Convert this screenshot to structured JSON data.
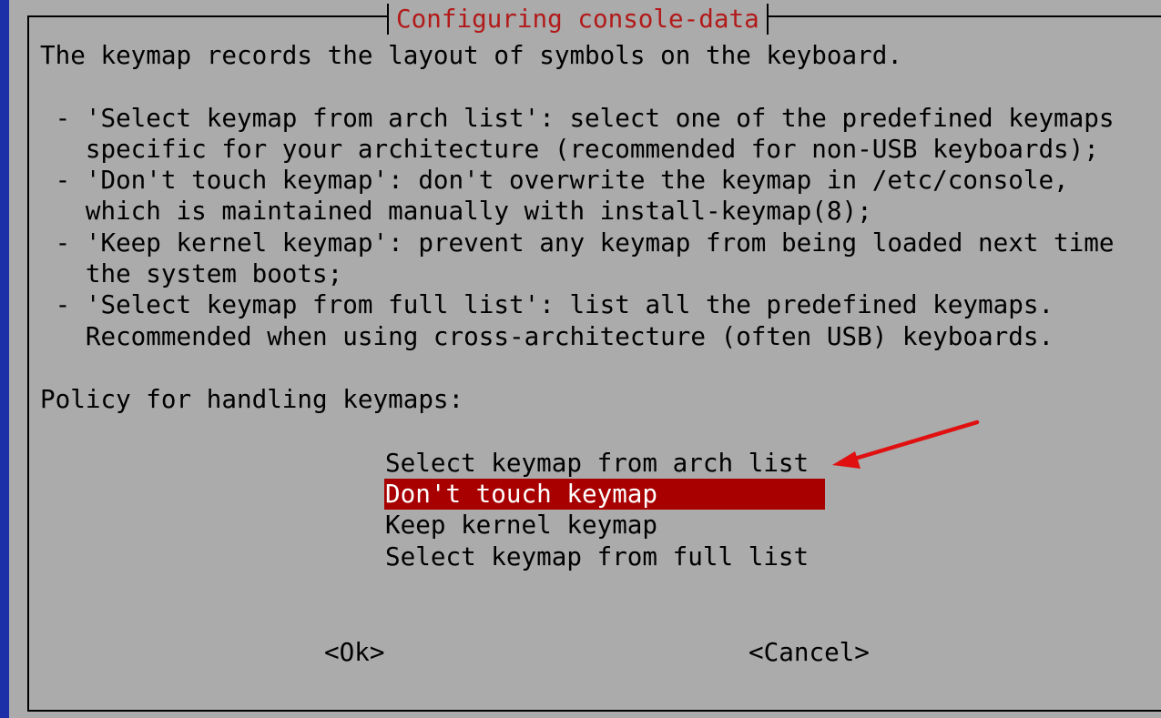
{
  "dialog": {
    "title": "Configuring console-data",
    "description": [
      "The keymap records the layout of symbols on the keyboard.",
      "",
      " - 'Select keymap from arch list': select one of the predefined keymaps",
      "   specific for your architecture (recommended for non-USB keyboards);",
      " - 'Don't touch keymap': don't overwrite the keymap in /etc/console,",
      "   which is maintained manually with install-keymap(8);",
      " - 'Keep kernel keymap': prevent any keymap from being loaded next time",
      "   the system boots;",
      " - 'Select keymap from full list': list all the predefined keymaps.",
      "   Recommended when using cross-architecture (often USB) keyboards.",
      "",
      "Policy for handling keymaps:"
    ]
  },
  "menu": {
    "items": [
      "Select keymap from arch list",
      "Don't touch keymap",
      "Keep kernel keymap",
      "Select keymap from full list"
    ],
    "selected_index": 1
  },
  "buttons": {
    "ok": "<Ok>",
    "cancel": "<Cancel>"
  },
  "colors": {
    "desktop_background": "#1c2fa8",
    "dialog_background": "#ababab",
    "title_color": "#b21a1a",
    "selection_background": "#a80000",
    "selection_text": "#ffffff",
    "annotation_arrow": "#e01010"
  }
}
